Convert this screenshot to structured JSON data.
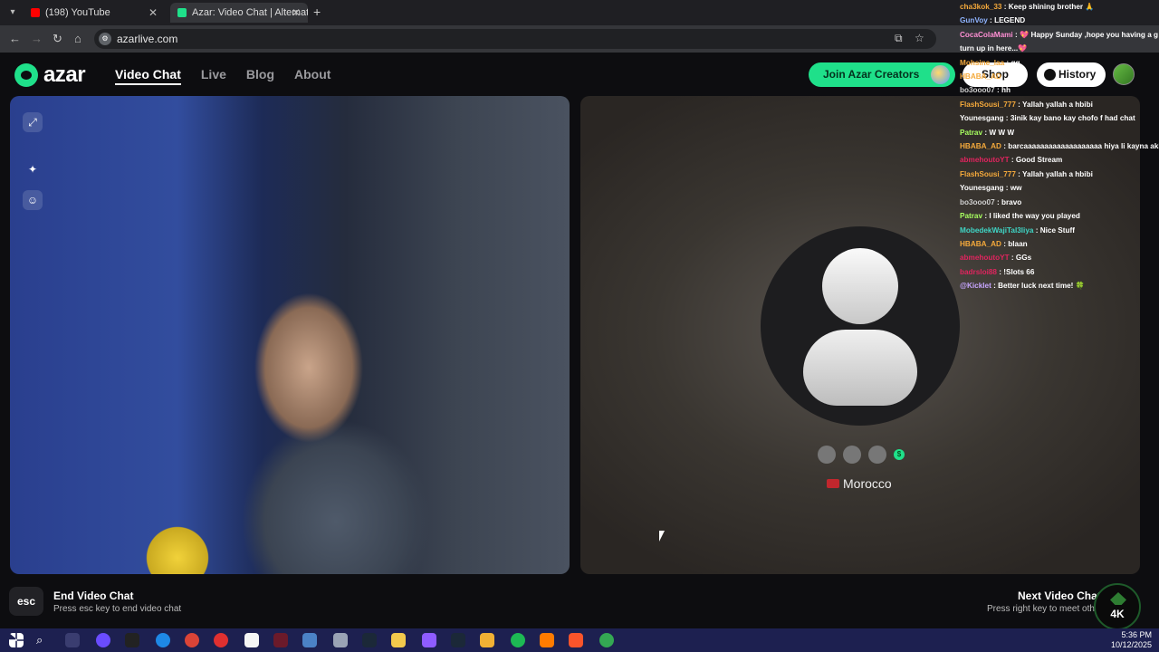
{
  "browser": {
    "tabs": [
      {
        "title": "(198) YouTube",
        "favicon_color": "#ff0000"
      },
      {
        "title": "Azar: Video Chat | Alternati",
        "favicon_color": "#1fe08a"
      }
    ],
    "url": "azarlive.com"
  },
  "header": {
    "logo": "azar",
    "nav": [
      "Video Chat",
      "Live",
      "Blog",
      "About"
    ],
    "creators_button": "Join Azar Creators",
    "shop_button": "Shop",
    "history_button": "History"
  },
  "partner": {
    "country": "Morocco",
    "badge": "$"
  },
  "footer": {
    "esc_key": "esc",
    "end_title": "End Video Chat",
    "end_sub": "Press esc key to end video chat",
    "next_title": "Next Video Chat",
    "next_sub": "Press right key to meet other"
  },
  "chat": [
    {
      "user": "cha3kok_33",
      "msg": "Keep shining brother 🙏",
      "color": "#f4a93b"
    },
    {
      "user": "GunVoy",
      "msg": "LEGEND",
      "color": "#8fb4ff"
    },
    {
      "user": "CocaColaMami",
      "msg": "💖 Happy Sunday ,hope you having a g",
      "color": "#ff8fd4"
    },
    {
      "user": "",
      "msg": "turn up in here...💖",
      "color": "#ffffff"
    },
    {
      "user": "Mohsine_laa",
      "msg": "gg",
      "color": "#f4a93b"
    },
    {
      "user": "HBABA_AD",
      "msg": "hhhh",
      "color": "#f4a93b"
    },
    {
      "user": "bo3ooo07",
      "msg": "hh",
      "color": "#cfcfcf"
    },
    {
      "user": "FlashSousi_777",
      "msg": "Yallah yallah a hbibi",
      "color": "#f4a93b"
    },
    {
      "user": "Younesgang",
      "msg": "3inik kay bano kay chofo f had chat",
      "color": "#ffffff"
    },
    {
      "user": "Patrav",
      "msg": "W W W",
      "color": "#a8ff60"
    },
    {
      "user": "HBABA_AD",
      "msg": "barcaaaaaaaaaaaaaaaaaaa hiya li kayna aki",
      "color": "#f4a93b"
    },
    {
      "user": "abmehoutoYT",
      "msg": "Good Stream",
      "color": "#e0245e"
    },
    {
      "user": "FlashSousi_777",
      "msg": "Yallah yallah a hbibi",
      "color": "#f4a93b"
    },
    {
      "user": "Younesgang",
      "msg": "ww",
      "color": "#ffffff"
    },
    {
      "user": "bo3ooo07",
      "msg": "bravo",
      "color": "#cfcfcf"
    },
    {
      "user": "Patrav",
      "msg": "I liked the way you played",
      "color": "#a8ff60"
    },
    {
      "user": "MobedekWajiTal3liya",
      "msg": "Nice Stuff",
      "color": "#3fd6c6"
    },
    {
      "user": "HBABA_AD",
      "msg": "blaan",
      "color": "#f4a93b"
    },
    {
      "user": "abmehoutoYT",
      "msg": "GGs",
      "color": "#e0245e"
    },
    {
      "user": "badrsloi88",
      "msg": "!Slots 66",
      "color": "#e0245e"
    },
    {
      "user": "@Kicklet",
      "msg": "Better luck next time! 🍀",
      "color": "#c7a5ff"
    }
  ],
  "watermark": "4K",
  "taskbar": {
    "time": "5:36 PM",
    "date": "10/12/2025"
  }
}
